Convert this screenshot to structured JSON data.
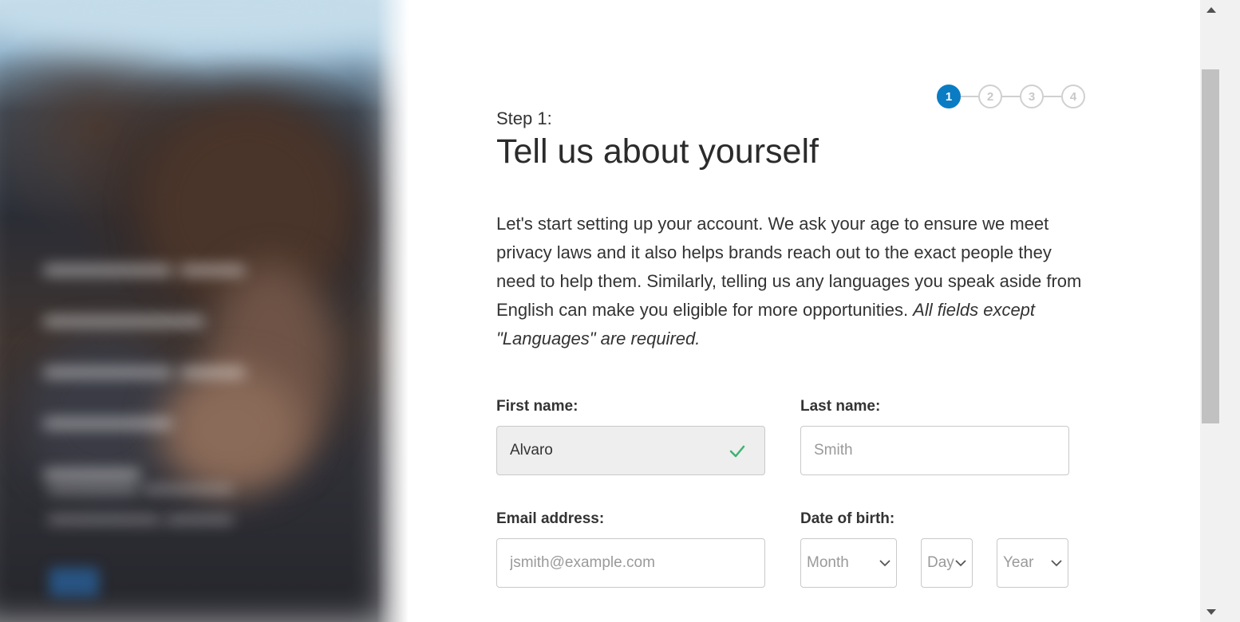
{
  "stepper": {
    "steps": [
      "1",
      "2",
      "3",
      "4"
    ],
    "active_index": 0
  },
  "header": {
    "step_label": "Step 1:",
    "title": "Tell us about yourself"
  },
  "intro": {
    "text": "Let's start setting up your account. We ask your age to ensure we meet privacy laws and it also helps brands reach out to the exact people they need to help them. Similarly, telling us any languages you speak aside from English can make you eligible for more opportunities. ",
    "emphasis": "All fields except \"Languages\" are required."
  },
  "form": {
    "first_name": {
      "label": "First name:",
      "value": "Alvaro",
      "valid": true
    },
    "last_name": {
      "label": "Last name:",
      "value": "",
      "placeholder": "Smith"
    },
    "email": {
      "label": "Email address:",
      "value": "",
      "placeholder": "jsmith@example.com"
    },
    "dob": {
      "label": "Date of birth:",
      "month": "Month",
      "day": "Day",
      "year": "Year"
    }
  },
  "colors": {
    "accent": "#0a7cc4",
    "valid": "#3cb371",
    "filled_bg": "#eeeeee"
  },
  "icons": {
    "valid": "checkmark-icon",
    "select": "chevron-down-icon"
  }
}
